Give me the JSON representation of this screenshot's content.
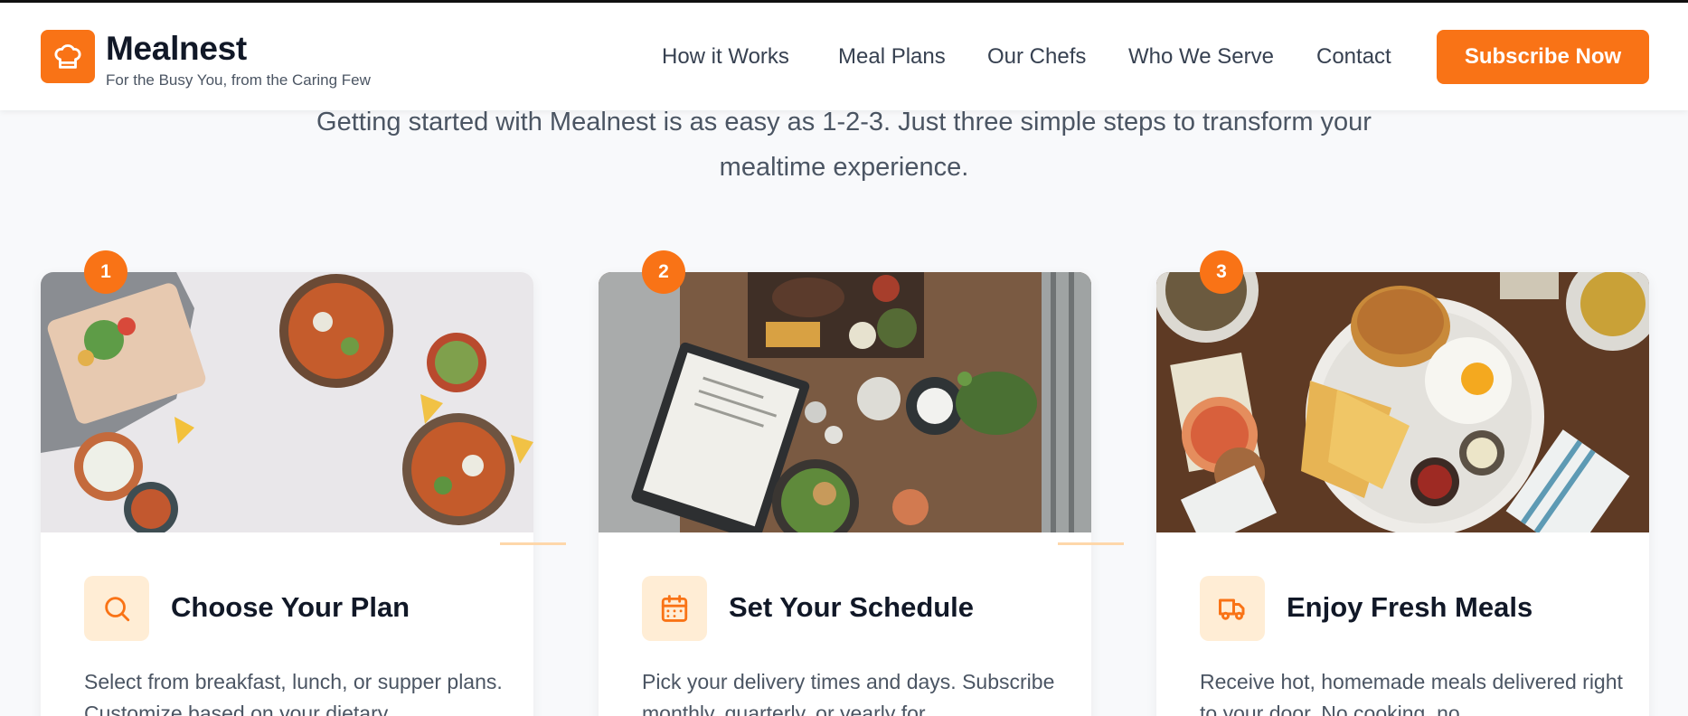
{
  "brand": {
    "name": "Mealnest",
    "tagline": "For the Busy You, from the Caring Few",
    "accent_color": "#f97316",
    "logo_icon": "chef-hat-icon"
  },
  "nav": {
    "links": [
      "How it Works",
      "Meal Plans",
      "Our Chefs",
      "Who We Serve",
      "Contact"
    ],
    "cta_label": "Subscribe Now"
  },
  "intro": {
    "text": "Getting started with Mealnest is as easy as 1-2-3. Just three simple steps to transform your mealtime experience."
  },
  "steps": [
    {
      "number": "1",
      "icon": "search-icon",
      "title": "Choose Your Plan",
      "description": "Select from breakfast, lunch, or supper plans. Customize based on your dietary",
      "image": "overhead photo of salads, loaded fries and dips on a light table"
    },
    {
      "number": "2",
      "icon": "calendar-icon",
      "title": "Set Your Schedule",
      "description": "Pick your delivery times and days. Subscribe monthly, quarterly, or yearly for",
      "image": "overhead photo of a restaurant table with a clipboard menu and dishes"
    },
    {
      "number": "3",
      "icon": "truck-icon",
      "title": "Enjoy Fresh Meals",
      "description": "Receive hot, homemade meals delivered right to your door. No cooking, no",
      "image": "overhead photo of a burger, fries and fried egg plate"
    }
  ]
}
